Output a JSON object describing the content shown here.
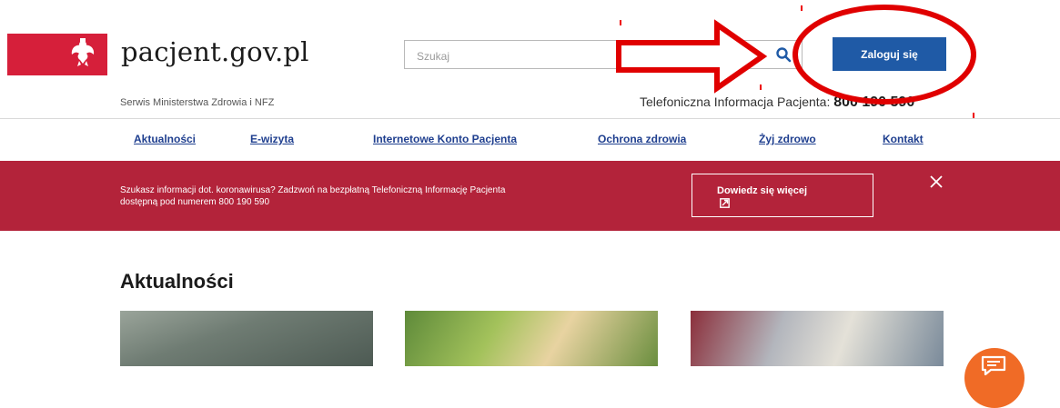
{
  "header": {
    "site_name": "pacjent.gov.pl",
    "site_sub": "Serwis Ministerstwa Zdrowia i NFZ",
    "search": {
      "placeholder": "Szukaj",
      "value": ""
    },
    "login_label": "Zaloguj się",
    "phone_label": "Telefoniczna Informacja Pacjenta:",
    "phone_number": "800 190 590"
  },
  "nav": {
    "items": [
      {
        "label": "Aktualności"
      },
      {
        "label": "E-wizyta"
      },
      {
        "label": "Internetowe Konto Pacjenta"
      },
      {
        "label": "Ochrona zdrowia"
      },
      {
        "label": "Żyj zdrowo"
      },
      {
        "label": "Kontakt"
      }
    ]
  },
  "banner": {
    "text_line1": "Szukasz informacji dot. koronawirusa? Zadzwoń na bezpłatną Telefoniczną Informację Pacjenta",
    "text_line2": "dostępną pod numerem 800 190 590",
    "button_label": "Dowiedz się więcej"
  },
  "main": {
    "section_title": "Aktualności"
  },
  "colors": {
    "brand_red": "#b3233a",
    "flag_red": "#d61f3a",
    "link_blue": "#1f3f8f",
    "login_blue": "#1f5aa6",
    "chat_orange": "#f06b26",
    "annotation_red": "#e00000"
  },
  "icons": {
    "logo": "polish-eagle-icon",
    "search": "search-icon",
    "external": "external-link-icon",
    "close": "close-icon",
    "chat": "chat-icon",
    "annotation_arrow": "arrow-right-icon",
    "annotation_circle": "ellipse-highlight-icon"
  }
}
